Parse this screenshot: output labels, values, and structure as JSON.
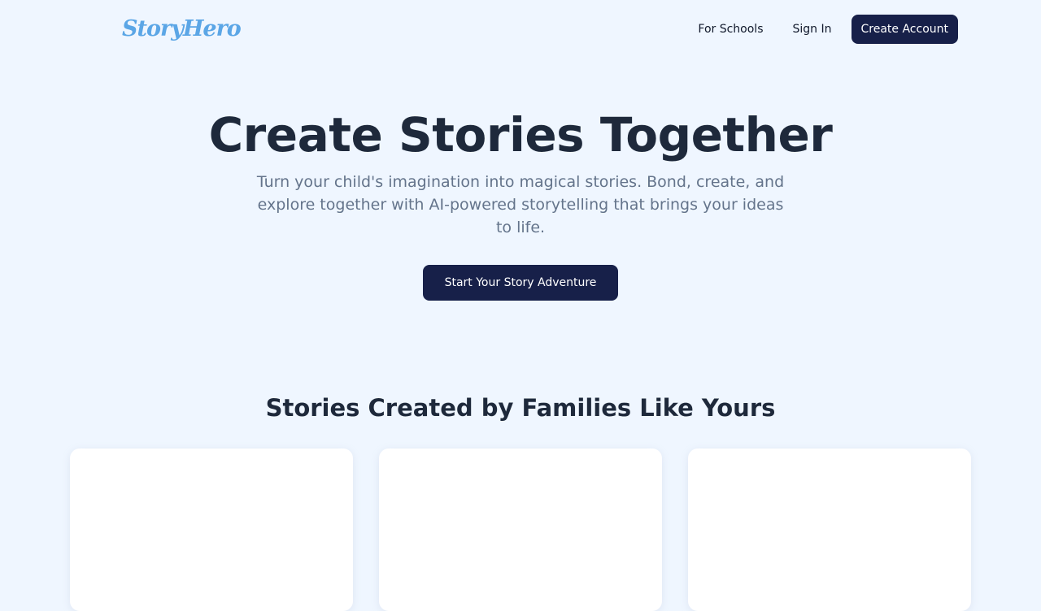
{
  "header": {
    "logo": "StoryHero",
    "nav": {
      "schools_label": "For Schools",
      "signin_label": "Sign In",
      "create_account_label": "Create Account"
    }
  },
  "hero": {
    "title": "Create Stories Together",
    "subtitle": "Turn your child's imagination into magical stories. Bond, create, and explore together with AI-powered storytelling that brings your ideas to life.",
    "cta_label": "Start Your Story Adventure"
  },
  "stories": {
    "title": "Stories Created by Families Like Yours",
    "cards": [
      {},
      {},
      {}
    ]
  },
  "colors": {
    "background": "#eff6ff",
    "brand": "#5ba6e6",
    "primary_button": "#172049",
    "heading": "#1e293b",
    "body_text": "#64748b"
  }
}
